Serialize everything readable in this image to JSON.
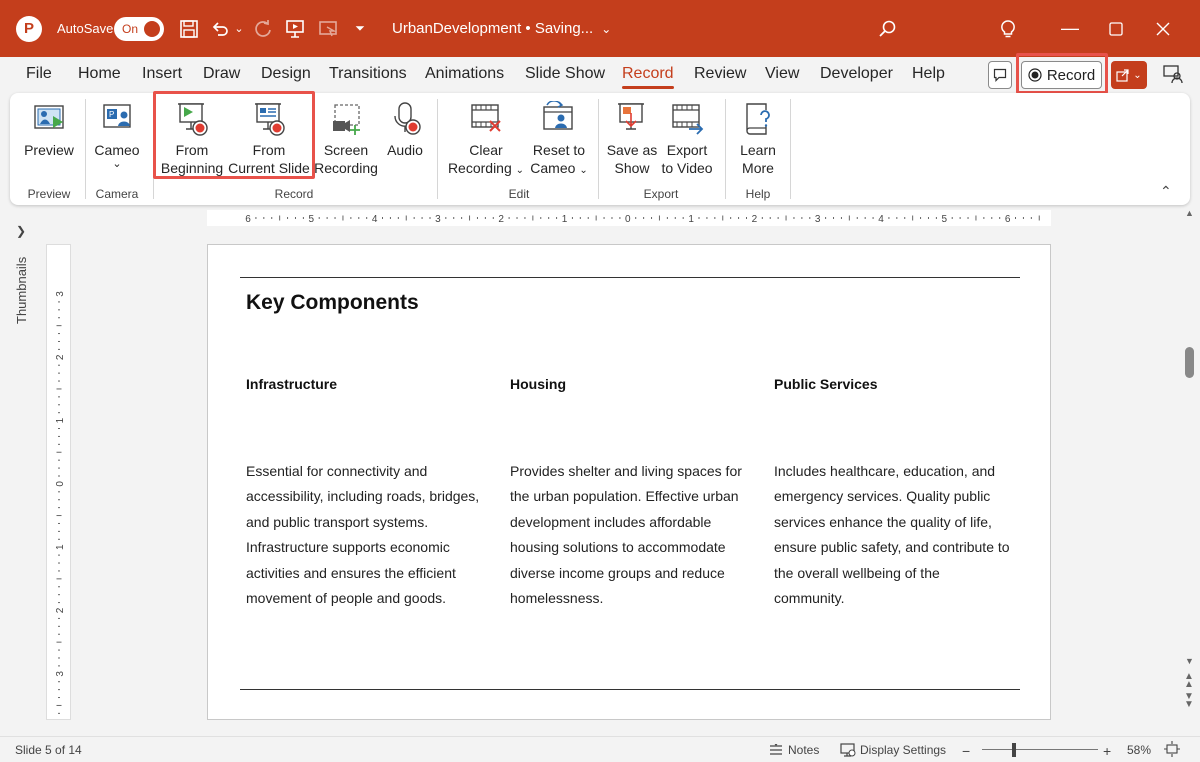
{
  "titlebar": {
    "autosave_label": "AutoSave",
    "toggle_label": "On",
    "doc_title": "UrbanDevelopment • Saving...",
    "accent_color": "#c43e1c"
  },
  "menu": {
    "tabs": [
      "File",
      "Home",
      "Insert",
      "Draw",
      "Design",
      "Transitions",
      "Animations",
      "Slide Show",
      "Record",
      "Review",
      "View",
      "Developer",
      "Help"
    ],
    "active_tab": "Record",
    "record_button": "Record"
  },
  "ribbon": {
    "preview": "Preview",
    "cameo": "Cameo",
    "from_beginning_1": "From",
    "from_beginning_2": "Beginning",
    "from_current_1": "From",
    "from_current_2": "Current Slide",
    "screen_recording_1": "Screen",
    "screen_recording_2": "Recording",
    "audio": "Audio",
    "clear_recording_1": "Clear",
    "clear_recording_2": "Recording",
    "reset_cameo_1": "Reset to",
    "reset_cameo_2": "Cameo",
    "save_show_1": "Save as",
    "save_show_2": "Show",
    "export_video_1": "Export",
    "export_video_2": "to Video",
    "learn_more_1": "Learn",
    "learn_more_2": "More",
    "groups": {
      "preview": "Preview",
      "camera": "Camera",
      "record": "Record",
      "edit": "Edit",
      "export": "Export",
      "help": "Help"
    }
  },
  "ruler": {
    "h_numbers": [
      "6",
      "5",
      "4",
      "3",
      "2",
      "1",
      "0",
      "1",
      "2",
      "3",
      "4",
      "5",
      "6"
    ],
    "v_numbers": [
      "3",
      "2",
      "1",
      "0",
      "1",
      "2",
      "3"
    ]
  },
  "thumbnails_label": "Thumbnails",
  "slide": {
    "title": "Key Components",
    "columns": [
      {
        "heading": "Infrastructure",
        "lines": [
          "Essential for connectivity and",
          "accessibility, including roads, bridges,",
          "and public transport systems.",
          "Infrastructure supports economic",
          "activities and ensures the efficient",
          "movement of people and goods."
        ]
      },
      {
        "heading": "Housing",
        "lines": [
          "Provides shelter and living spaces for",
          "the urban population. Effective urban",
          "development includes affordable",
          "housing solutions to accommodate",
          "diverse income groups and reduce",
          "homelessness."
        ]
      },
      {
        "heading": "Public Services",
        "lines": [
          "Includes healthcare, education, and",
          "emergency services. Quality public",
          "services enhance the quality of life,",
          "ensure public safety, and contribute to",
          "the overall wellbeing of the",
          "community."
        ]
      }
    ]
  },
  "status": {
    "slide_info": "Slide 5 of 14",
    "notes": "Notes",
    "display_settings": "Display Settings",
    "zoom": "58%"
  }
}
